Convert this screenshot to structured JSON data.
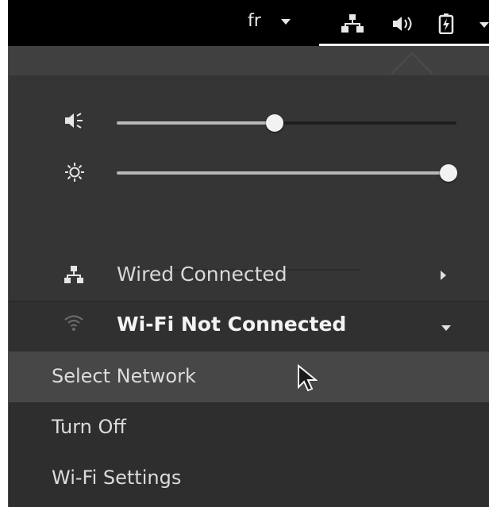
{
  "topbar": {
    "language": "fr",
    "icons": [
      "network-wired-icon",
      "volume-icon",
      "battery-charging-icon",
      "chevron-down-icon"
    ]
  },
  "menu": {
    "volume_slider": {
      "icon": "audio-volume-low-icon",
      "value": 0.47
    },
    "brightness_slider": {
      "icon": "brightness-icon",
      "value": 1.0
    },
    "wired": {
      "label": "Wired Connected",
      "icon": "network-wired-icon"
    },
    "wifi": {
      "label": "Wi-Fi Not Connected",
      "icon": "wifi-icon",
      "submenu": [
        "Select Network",
        "Turn Off",
        "Wi-Fi Settings"
      ]
    }
  },
  "colors": {
    "panel_bg": "#353535",
    "topbar_bg": "#000000",
    "hover_bg": "#474747",
    "slider_fill": "#b8b8b8"
  }
}
